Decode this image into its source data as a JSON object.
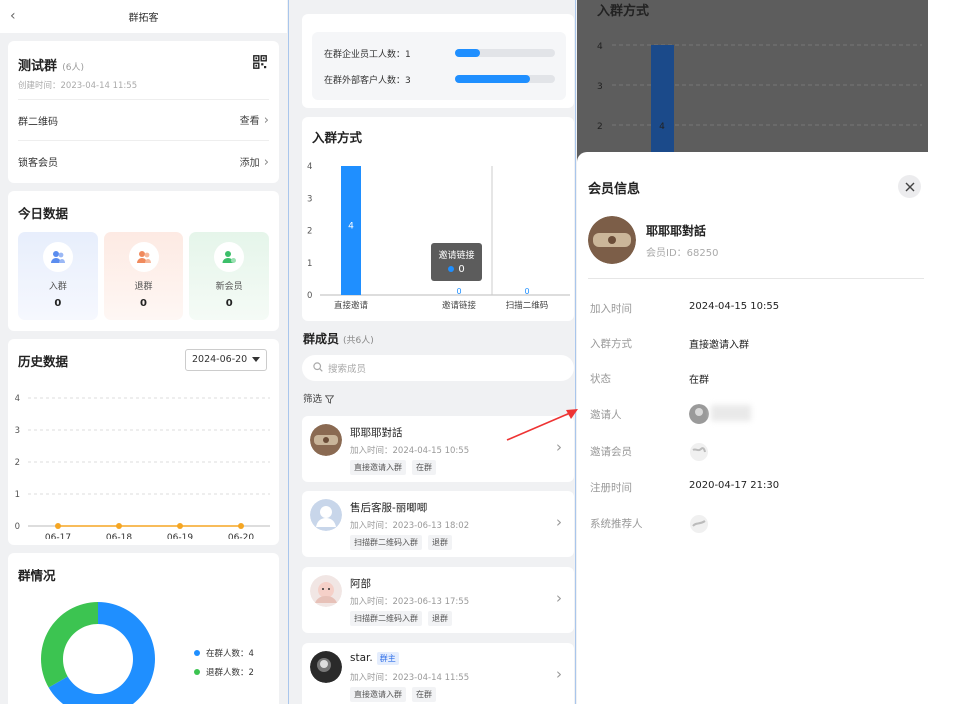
{
  "left": {
    "topbar_title": "群拓客",
    "group": {
      "name": "测试群",
      "count": "(6人)",
      "created": "创建时间：2023-04-14 11:55",
      "rows": [
        {
          "label": "群二维码",
          "action": "查看"
        },
        {
          "label": "锁客会员",
          "action": "添加"
        }
      ]
    },
    "today": {
      "title": "今日数据",
      "stats": [
        {
          "label": "入群",
          "value": "0"
        },
        {
          "label": "退群",
          "value": "0"
        },
        {
          "label": "新会员",
          "value": "0"
        }
      ]
    },
    "history": {
      "title": "历史数据",
      "date": "2024-06-20"
    },
    "situation": {
      "title": "群情况",
      "legend": [
        {
          "label": "在群人数：4",
          "color": "#1f8fff"
        },
        {
          "label": "退群人数：2",
          "color": "#3cc451"
        }
      ]
    }
  },
  "middle": {
    "composition": [
      {
        "label": "在群企业员工人数：",
        "value": "1"
      },
      {
        "label": "在群外部客户人数：",
        "value": "3"
      }
    ],
    "join_title": "入群方式",
    "tooltip": {
      "title": "邀请链接",
      "value": "0"
    },
    "members_title": "群成员",
    "members_count": "(共6人)",
    "search_placeholder": "搜索成员",
    "filter_label": "筛选",
    "members": [
      {
        "name": "耶耶耶對話",
        "time": "加入时间：2024-04-15 10:55",
        "tags": [
          "直接邀请入群",
          "在群"
        ],
        "owner": ""
      },
      {
        "name": "售后客服-丽唧唧",
        "time": "加入时间：2023-06-13 18:02",
        "tags": [
          "扫描群二维码入群",
          "退群"
        ],
        "owner": ""
      },
      {
        "name": "阿部",
        "time": "加入时间：2023-06-13 17:55",
        "tags": [
          "扫描群二维码入群",
          "退群"
        ],
        "owner": ""
      },
      {
        "name": "star.",
        "time": "加入时间：2023-04-14 11:55",
        "tags": [
          "直接邀请入群",
          "在群"
        ],
        "owner": "群主"
      }
    ]
  },
  "right": {
    "bg_title": "入群方式",
    "drawer_title": "会员信息",
    "profile_name": "耶耶耶對話",
    "profile_id": "会员ID：68250",
    "info": [
      {
        "label": "加入时间",
        "value": "2024-04-15 10:55"
      },
      {
        "label": "入群方式",
        "value": "直接邀请入群"
      },
      {
        "label": "状态",
        "value": "在群"
      },
      {
        "label": "邀请人",
        "value": ""
      },
      {
        "label": "邀请会员",
        "value": ""
      },
      {
        "label": "注册时间",
        "value": "2020-04-17 21:30"
      },
      {
        "label": "系统推荐人",
        "value": ""
      }
    ]
  },
  "chart_data": [
    {
      "type": "line",
      "title": "历史数据",
      "categories": [
        "06-17",
        "06-18",
        "06-19",
        "06-20"
      ],
      "series": [
        {
          "name": "",
          "values": [
            0,
            0,
            0,
            0
          ]
        }
      ],
      "ylim": [
        0,
        4
      ],
      "yticks": [
        0,
        1,
        2,
        3,
        4
      ],
      "grid": true,
      "color": "#f5a623"
    },
    {
      "type": "bar",
      "title": "入群方式",
      "categories": [
        "直接邀请",
        "邀请链接",
        "扫描二维码"
      ],
      "values": [
        4,
        0,
        0
      ],
      "ylim": [
        0,
        4
      ],
      "yticks": [
        0,
        1,
        2,
        3,
        4
      ],
      "color": "#1f8fff"
    },
    {
      "type": "pie",
      "title": "群情况",
      "labels": [
        "在群人数",
        "退群人数"
      ],
      "values": [
        4,
        2
      ],
      "colors": [
        "#1f8fff",
        "#3cc451"
      ]
    },
    {
      "type": "bar",
      "title": "入群方式",
      "categories": [],
      "values": [
        4
      ],
      "yticks": [
        2,
        3,
        4
      ],
      "color": "#1b4a8a"
    }
  ]
}
